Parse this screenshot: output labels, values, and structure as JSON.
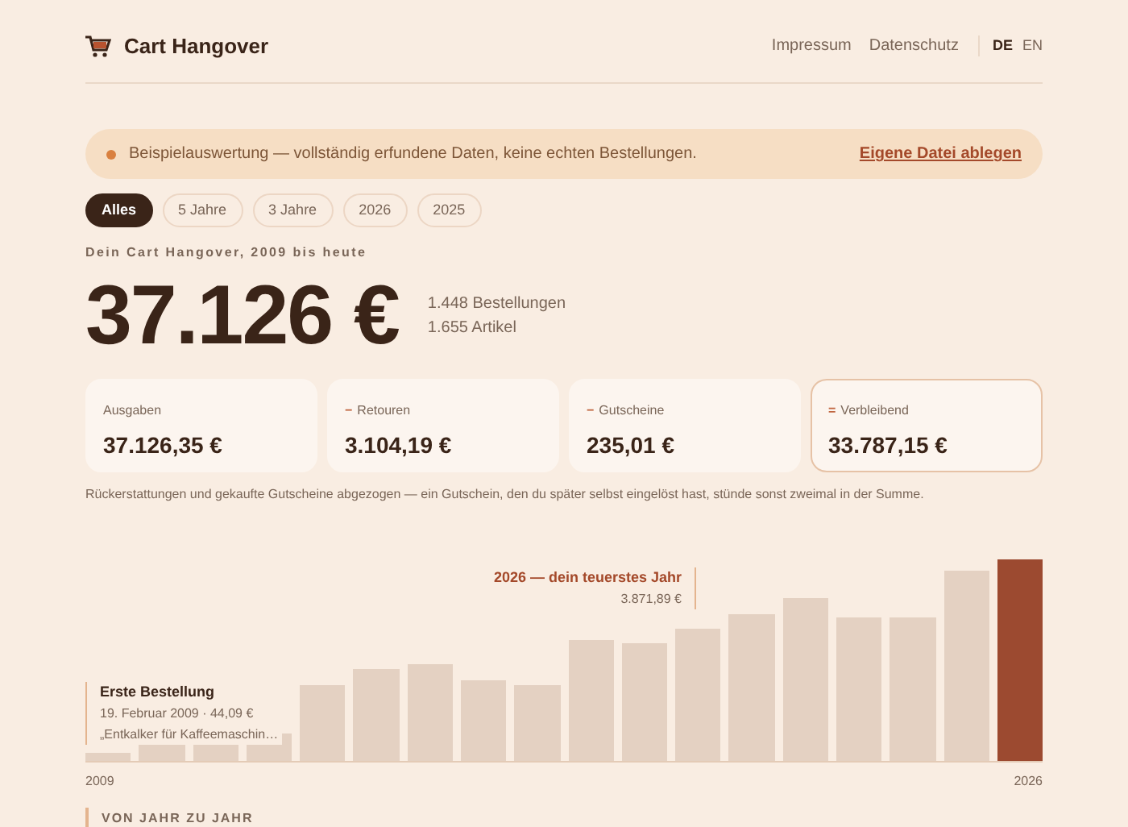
{
  "header": {
    "brand": "Cart Hangover",
    "links": [
      "Impressum",
      "Datenschutz"
    ],
    "languages": [
      {
        "label": "DE",
        "selected": true
      },
      {
        "label": "EN",
        "selected": false
      }
    ]
  },
  "banner": {
    "text": "Beispielauswertung — vollständig erfundene Daten, keine echten Bestellungen.",
    "link": "Eigene Datei ablegen"
  },
  "filters": [
    {
      "label": "Alles",
      "selected": true
    },
    {
      "label": "5 Jahre",
      "selected": false
    },
    {
      "label": "3 Jahre",
      "selected": false
    },
    {
      "label": "2026",
      "selected": false
    },
    {
      "label": "2025",
      "selected": false
    }
  ],
  "subtitle": "Dein Cart Hangover, 2009 bis heute",
  "total": "37.126 €",
  "stats": [
    "1.448 Bestellungen",
    "1.655 Artikel"
  ],
  "cards": [
    {
      "label": "Ausgaben",
      "value": "37.126,35 €",
      "highlighted": false
    },
    {
      "sign": "−",
      "label": "Retouren",
      "value": "3.104,19 €",
      "highlighted": false
    },
    {
      "sign": "−",
      "label": "Gutscheine",
      "value": "235,01 €",
      "highlighted": false
    },
    {
      "sign": "=",
      "label": "Verbleibend",
      "value": "33.787,15 €",
      "highlighted": true
    }
  ],
  "note": "Rückerstattungen und gekaufte Gutscheine abgezogen — ein Gutschein, den du später selbst eingelöst hast, stünde sonst zweimal in der Summe.",
  "chart": {
    "first_order": {
      "title": "Erste Bestellung",
      "date": "19. Februar 2009 · 44,09 €",
      "item": "„Entkalker für Kaffeemaschin…"
    },
    "top_year": {
      "title": "2026 — dein teuerstes Jahr",
      "value": "3.871,89 €"
    },
    "axis_start": "2009",
    "axis_end": "2026"
  },
  "next_section": "VON JAHR ZU JAHR"
}
